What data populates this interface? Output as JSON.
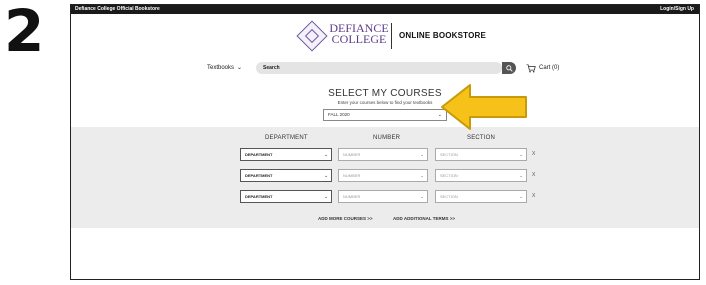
{
  "step_number": "2",
  "topbar": {
    "site_name": "Defiance College Official Bookstore",
    "login": "Login/Sign Up"
  },
  "logo": {
    "line1": "DEFIANCE",
    "line2": "COLLEGE",
    "store_title": "ONLINE BOOKSTORE"
  },
  "nav": {
    "textbooks": "Textbooks",
    "search_placeholder": "Search",
    "cart": "Cart (0)"
  },
  "courses": {
    "heading": "SELECT MY COURSES",
    "subheading": "Enter your courses below to find your textbooks",
    "term": "FALL 2020",
    "columns": {
      "department": "DEPARTMENT",
      "number": "NUMBER",
      "section": "SECTION"
    },
    "rows": [
      {
        "department": "DEPARTMENT",
        "number": "NUMBER",
        "section": "SECTION",
        "remove": "X"
      },
      {
        "department": "DEPARTMENT",
        "number": "NUMBER",
        "section": "SECTION",
        "remove": "X"
      },
      {
        "department": "DEPARTMENT",
        "number": "NUMBER",
        "section": "SECTION",
        "remove": "X"
      }
    ],
    "add_more": "ADD MORE COURSES >>",
    "add_terms": "ADD ADDITIONAL TERMS >>"
  },
  "colors": {
    "purple": "#5b3c8e",
    "arrow_fill": "#f6c21a",
    "arrow_stroke": "#c99a08",
    "panel": "#ececec"
  },
  "icons": [
    "search-icon",
    "cart-icon",
    "chevron-down-icon",
    "college-seal-icon",
    "pointer-arrow-icon"
  ]
}
